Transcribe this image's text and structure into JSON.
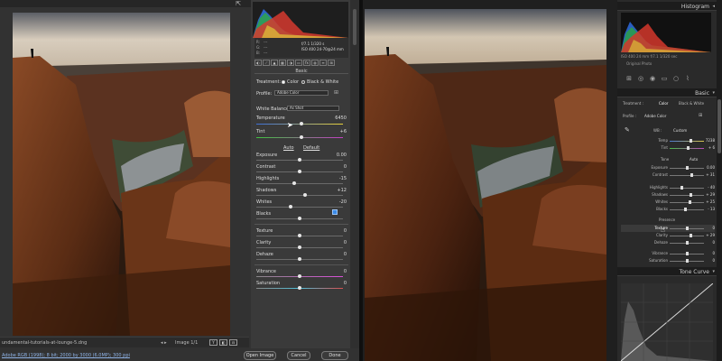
{
  "colors": {
    "acr_bg": "#323232",
    "acr_panel": "#3a3a3a",
    "lr_bg": "#1f1f1f",
    "lr_panel": "#2a2a2a",
    "accent_blue": "#3b8be8",
    "link_blue": "#8fb3e6"
  },
  "acr": {
    "histogram": {
      "rgb_labels": [
        "R:",
        "G:",
        "B:"
      ],
      "rgb_values": [
        "---",
        "---",
        "---"
      ],
      "camera_line1": "f/7.1  1/320 s",
      "camera_line2": "ISO 400  24-70@24 mm"
    },
    "panel": {
      "section_title": "Basic",
      "treatment_label": "Treatment:",
      "treatment_color": "Color",
      "treatment_bw": "Black & White",
      "profile_label": "Profile:",
      "profile_value": "Adobe Color",
      "wb_label": "White Balance:",
      "wb_value": "As Shot",
      "temperature_label": "Temperature",
      "temperature_value": "6450",
      "tint_label": "Tint",
      "tint_value": "+6",
      "auto_label": "Auto",
      "default_label": "Default",
      "sliders": [
        {
          "label": "Exposure",
          "value": "0.00"
        },
        {
          "label": "Contrast",
          "value": "0"
        },
        {
          "label": "Highlights",
          "value": "-15"
        },
        {
          "label": "Shadows",
          "value": "+12"
        },
        {
          "label": "Whites",
          "value": "-20"
        },
        {
          "label": "Blacks",
          "value": ""
        }
      ],
      "presence": [
        {
          "label": "Texture",
          "value": "0"
        },
        {
          "label": "Clarity",
          "value": "0"
        },
        {
          "label": "Dehaze",
          "value": "0"
        }
      ],
      "color_sliders": [
        {
          "label": "Vibrance",
          "value": "0"
        },
        {
          "label": "Saturation",
          "value": "0"
        }
      ]
    },
    "status": {
      "filename": "undamental-tutorials-at-lounge-5.dng",
      "nav": "◂ ▸",
      "counter": "Image 1/1",
      "view_buttons": [
        "Y",
        "◧",
        "⊟"
      ]
    },
    "footer": {
      "info_link": "Adobe RGB (1998); 8 bit; 2000 by 3000 (6.0MP); 300 ppi",
      "open_image": "Open Image",
      "cancel": "Cancel",
      "done": "Done"
    }
  },
  "lr": {
    "histogram_title": "Histogram",
    "exif_line": "ISO 400   24 mm   f/7.1   1/320 sec",
    "original_photo": "Original Photo",
    "basic_title": "Basic",
    "treatment_label": "Treatment :",
    "treatment_color": "Color",
    "treatment_bw": "Black & White",
    "profile_label": "Profile :",
    "profile_value": "Adobe Color",
    "wb_label": "WB :",
    "wb_value": "Custom",
    "temp_label": "Temp",
    "temp_value": "7238",
    "tint_label": "Tint",
    "tint_value": "+ 6",
    "tone_label": "Tone",
    "tone_auto": "Auto",
    "tone_sliders": [
      {
        "label": "Exposure",
        "value": "0.00"
      },
      {
        "label": "Contrast",
        "value": "+ 31"
      },
      {
        "label": "Highlights",
        "value": "- 40"
      },
      {
        "label": "Shadows",
        "value": "+ 29"
      },
      {
        "label": "Whites",
        "value": "+ 25"
      },
      {
        "label": "Blacks",
        "value": "- 13"
      }
    ],
    "presence_label": "Presence",
    "presence_sliders": [
      {
        "label": "Texture",
        "value": "0"
      },
      {
        "label": "Clarity",
        "value": "+ 29"
      },
      {
        "label": "Dehaze",
        "value": "0"
      },
      {
        "label": "Vibrance",
        "value": "0"
      },
      {
        "label": "Saturation",
        "value": "0"
      }
    ],
    "tone_curve_title": "Tone Curve"
  }
}
